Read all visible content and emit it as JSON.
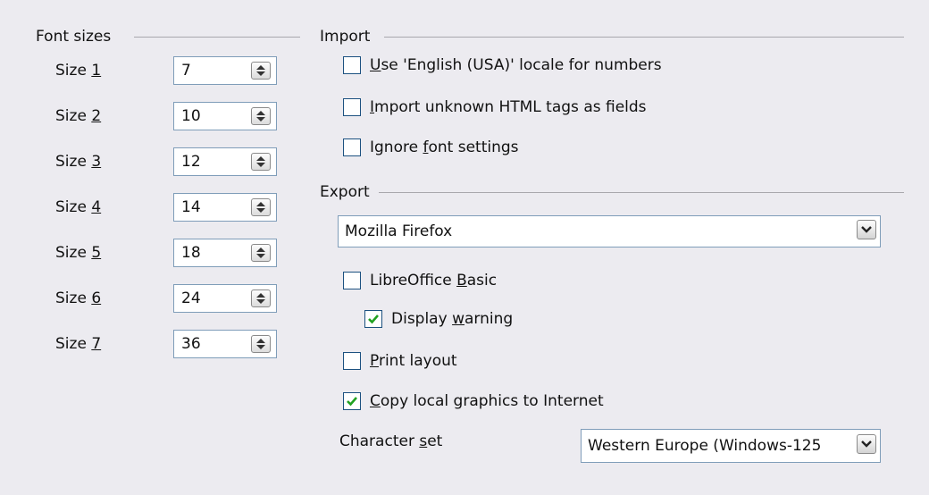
{
  "font_sizes": {
    "title": "Font sizes",
    "rows": [
      {
        "label_prefix": "Size ",
        "key": "1",
        "value": "7"
      },
      {
        "label_prefix": "Size ",
        "key": "2",
        "value": "10"
      },
      {
        "label_prefix": "Size ",
        "key": "3",
        "value": "12"
      },
      {
        "label_prefix": "Size ",
        "key": "4",
        "value": "14"
      },
      {
        "label_prefix": "Size ",
        "key": "5",
        "value": "18"
      },
      {
        "label_prefix": "Size ",
        "key": "6",
        "value": "24"
      },
      {
        "label_prefix": "Size ",
        "key": "7",
        "value": "36"
      }
    ]
  },
  "import": {
    "title": "Import",
    "english_locale": {
      "key": "U",
      "rest": "se 'English (USA)' locale for numbers",
      "checked": false
    },
    "unknown_tags": {
      "key": "I",
      "rest": "mport unknown HTML tags as fields",
      "checked": false
    },
    "ignore_font": {
      "before": "Ignore ",
      "key": "f",
      "rest": "ont settings",
      "checked": false
    }
  },
  "export": {
    "title": "Export",
    "browser_value": "Mozilla Firefox",
    "basic": {
      "before": "LibreOffice ",
      "key": "B",
      "rest": "asic",
      "checked": false
    },
    "warning": {
      "before": "Display ",
      "key": "w",
      "rest": "arning",
      "checked": true
    },
    "print_layout": {
      "key": "P",
      "rest": "rint layout",
      "checked": false
    },
    "copy_graphics": {
      "key": "C",
      "rest": "opy local graphics to Internet",
      "checked": true
    },
    "charset": {
      "before": "Character ",
      "key": "s",
      "rest": "et",
      "value": "Western Europe (Windows-125"
    }
  },
  "colors": {
    "background": "#ecebf0",
    "check": "#21a121",
    "field_border": "#7f9db9"
  }
}
